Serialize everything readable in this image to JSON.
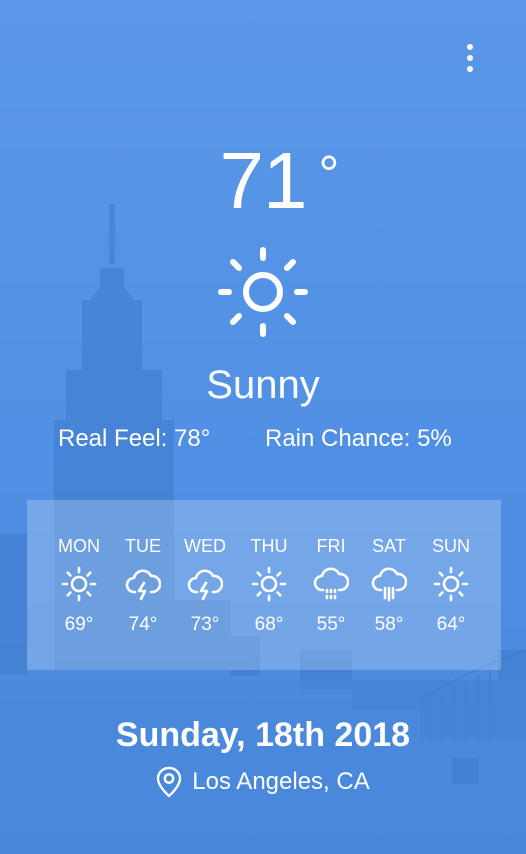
{
  "current": {
    "temperature": "71",
    "degree_symbol": "°",
    "condition": "Sunny",
    "icon": "sun-icon",
    "real_feel": "Real Feel: 78°",
    "rain_chance": "Rain Chance: 5%"
  },
  "forecast": [
    {
      "day": "MON",
      "icon": "sun-icon",
      "temp": "69°"
    },
    {
      "day": "TUE",
      "icon": "thunderstorm-icon",
      "temp": "74°"
    },
    {
      "day": "WED",
      "icon": "thunderstorm-icon",
      "temp": "73°"
    },
    {
      "day": "THU",
      "icon": "sun-icon",
      "temp": "68°"
    },
    {
      "day": "FRI",
      "icon": "drizzle-icon",
      "temp": "55°"
    },
    {
      "day": "SAT",
      "icon": "rain-icon",
      "temp": "58°"
    },
    {
      "day": "SUN",
      "icon": "sun-icon",
      "temp": "64°"
    }
  ],
  "footer": {
    "date": "Sunday, 18th 2018",
    "location": "Los Angeles, CA",
    "location_icon": "location-pin-icon"
  },
  "menu": {
    "icon": "more-vert-icon"
  },
  "colors": {
    "background": "#5090e4",
    "text": "#ffffff",
    "skyline": "#3f7fd0"
  }
}
